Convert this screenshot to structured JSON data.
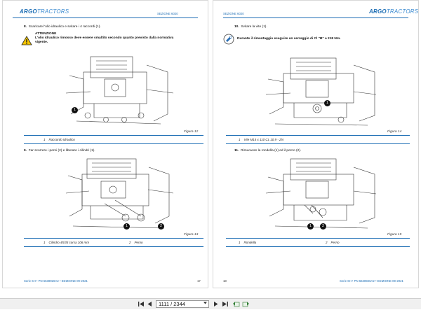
{
  "brand": {
    "logo_main": "ARGO",
    "logo_sub": "TRACTORS"
  },
  "left_page": {
    "section": "SEZIONE 6020",
    "step8": {
      "num": "8.",
      "text": "Scaricare l'olio idraulico e svitare i 4 raccordi (1)."
    },
    "warning": {
      "title": "ATTENZIONE",
      "line1": "L'olio idraulico rimosso deve essere smaltito secondo quanto previsto dalla normativa",
      "line2": "vigente."
    },
    "figure12": {
      "caption": "Figura 12",
      "callouts": [
        "1"
      ]
    },
    "legend12": [
      {
        "num": "1",
        "label": "Raccordo idraulico"
      }
    ],
    "step9": {
      "num": "9.",
      "text": "Far scorrere i perni (2) e liberare i cilindri (1)."
    },
    "figure13": {
      "caption": "Figura 13",
      "callouts": [
        "1",
        "2"
      ]
    },
    "legend13": [
      {
        "num": "1",
        "label": "Cilindro 45/35 corsa 106 mm"
      },
      {
        "num": "2",
        "label": "Perno"
      }
    ],
    "footer_left": "Serie 6H • PN 6638926A2 • EDIZIONE 09-2021",
    "footer_page": "17"
  },
  "right_page": {
    "section": "SEZIONE 6020",
    "step10": {
      "num": "10.",
      "text": "Svitare la vite (1)."
    },
    "note": {
      "text": "Durante il rimontaggio eseguire un serraggio di Cl \"B\" a 218 Nm."
    },
    "figure14": {
      "caption": "Figura 14",
      "callouts": [
        "1"
      ]
    },
    "legend14": [
      {
        "num": "1",
        "label": "Vite M14 x 110 CL 10.9 - ZN"
      }
    ],
    "step11": {
      "num": "11.",
      "text": "Rimuovere la rondella (1) ed il perno (2)."
    },
    "figure15": {
      "caption": "Figura 15",
      "callouts": [
        "1",
        "2"
      ]
    },
    "legend15": [
      {
        "num": "1",
        "label": "Rondella"
      },
      {
        "num": "2",
        "label": "Perno"
      }
    ],
    "footer_page": "18",
    "footer_right": "Serie 6H • PN 6638926A2 • EDIZIONE 09-2021"
  },
  "toolbar": {
    "page_field": "1111 / 2344",
    "icons": [
      "first-page-icon",
      "prev-page-icon",
      "page-dropdown-icon",
      "next-page-icon",
      "last-page-icon",
      "back-icon",
      "forward-icon"
    ]
  }
}
